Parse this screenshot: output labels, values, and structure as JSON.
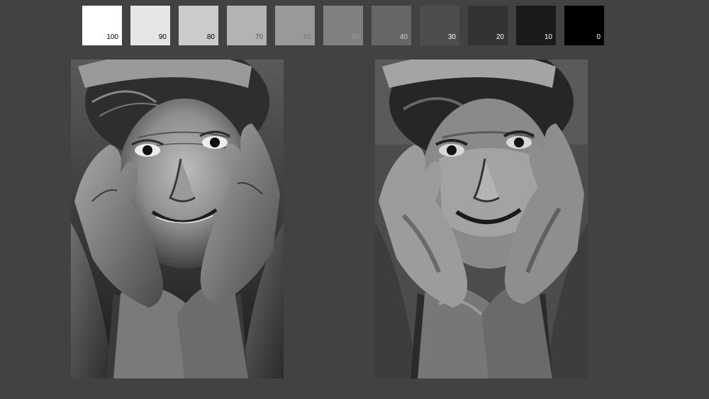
{
  "value_scale": {
    "swatches": [
      {
        "label": "100",
        "color": "#ffffff",
        "text_color": "#000000"
      },
      {
        "label": "90",
        "color": "#e6e6e6",
        "text_color": "#000000"
      },
      {
        "label": "80",
        "color": "#cccccc",
        "text_color": "#000000"
      },
      {
        "label": "70",
        "color": "#b3b3b3",
        "text_color": "#555555"
      },
      {
        "label": "60",
        "color": "#999999",
        "text_color": "#7a7a7a"
      },
      {
        "label": "50",
        "color": "#808080",
        "text_color": "#9a9a9a"
      },
      {
        "label": "40",
        "color": "#666666",
        "text_color": "#cfcfcf"
      },
      {
        "label": "30",
        "color": "#4d4d4d",
        "text_color": "#ffffff"
      },
      {
        "label": "20",
        "color": "#333333",
        "text_color": "#ffffff"
      },
      {
        "label": "10",
        "color": "#1a1a1a",
        "text_color": "#ffffff"
      },
      {
        "label": "0",
        "color": "#000000",
        "text_color": "#ffffff"
      }
    ]
  },
  "panels": {
    "left": {
      "kind": "grayscale-photo-portrait"
    },
    "right": {
      "kind": "grayscale-painted-study"
    }
  },
  "colors": {
    "background": "#424242"
  }
}
